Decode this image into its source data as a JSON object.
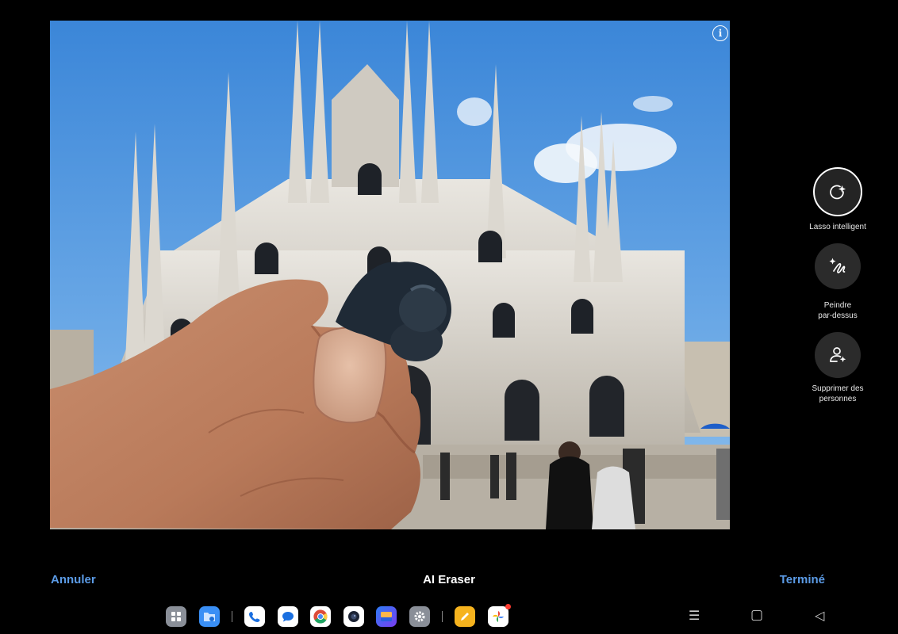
{
  "photo": {
    "info_icon": "info-icon",
    "info_glyph": "i"
  },
  "tools": [
    {
      "label": "Lasso intelligent",
      "icon": "lasso-sparkle-icon",
      "active": true
    },
    {
      "label": "Peindre\npar-dessus",
      "icon": "brush-sparkle-icon",
      "active": false
    },
    {
      "label": "Supprimer des\npersonnes",
      "icon": "remove-person-icon",
      "active": false
    }
  ],
  "bottom_bar": {
    "cancel": "Annuler",
    "title": "AI Eraser",
    "done": "Terminé"
  },
  "dock": {
    "apps": [
      {
        "name": "app-drawer-icon"
      },
      {
        "name": "files-icon"
      },
      {
        "name": "phone-icon"
      },
      {
        "name": "messages-icon"
      },
      {
        "name": "chrome-icon"
      },
      {
        "name": "camera-icon"
      },
      {
        "name": "gallery-icon"
      },
      {
        "name": "settings-icon"
      },
      {
        "name": "notes-icon"
      },
      {
        "name": "photos-icon"
      }
    ]
  },
  "nav": {
    "menu": "☰",
    "home": "▢",
    "back": "◁"
  }
}
